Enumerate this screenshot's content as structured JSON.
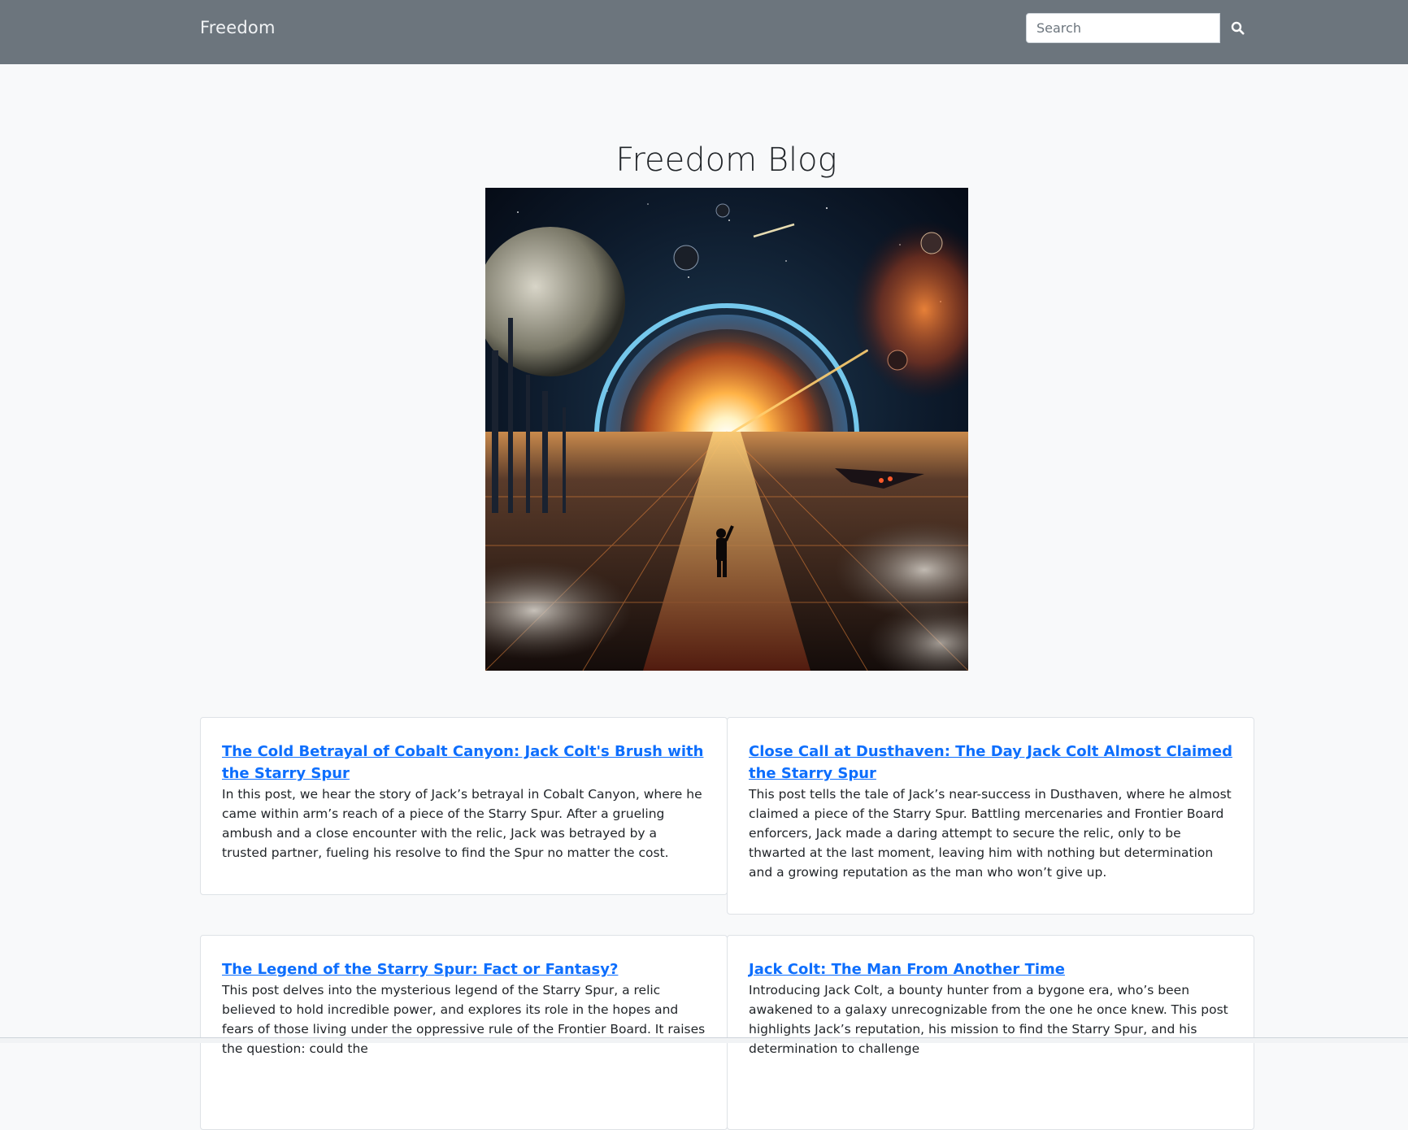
{
  "navbar": {
    "brand": "Freedom",
    "search": {
      "placeholder": "Search",
      "value": ""
    },
    "search_button_icon": "search-icon"
  },
  "main": {
    "title": "Freedom Blog",
    "hero_image": "space scene: figure walking toward a glowing portal ring with planets"
  },
  "posts": [
    {
      "title": "The Cold Betrayal of Cobalt Canyon: Jack Colt's Brush with the Starry Spur",
      "summary": "In this post, we hear the story of Jack’s betrayal in Cobalt Canyon, where he came within arm’s reach of a piece of the Starry Spur. After a grueling ambush and a close encounter with the relic, Jack was betrayed by a trusted partner, fueling his resolve to find the Spur no matter the cost."
    },
    {
      "title": "Close Call at Dusthaven: The Day Jack Colt Almost Claimed the Starry Spur",
      "summary": "This post tells the tale of Jack’s near-success in Dusthaven, where he almost claimed a piece of the Starry Spur. Battling mercenaries and Frontier Board enforcers, Jack made a daring attempt to secure the relic, only to be thwarted at the last moment, leaving him with nothing but determination and a growing reputation as the man who won’t give up."
    },
    {
      "title": "The Legend of the Starry Spur: Fact or Fantasy?",
      "summary": "This post delves into the mysterious legend of the Starry Spur, a relic believed to hold incredible power, and explores its role in the hopes and fears of those living under the oppressive rule of the Frontier Board. It raises the question: could the"
    },
    {
      "title": "Jack Colt: The Man From Another Time",
      "summary": "Introducing Jack Colt, a bounty hunter from a bygone era, who’s been awakened to a galaxy unrecognizable from the one he once knew. This post highlights Jack’s reputation, his mission to find the Starry Spur, and his determination to challenge"
    }
  ],
  "colors": {
    "navbar_bg": "#6c757d",
    "page_bg": "#f8f9fa",
    "link": "#0d6efd"
  }
}
